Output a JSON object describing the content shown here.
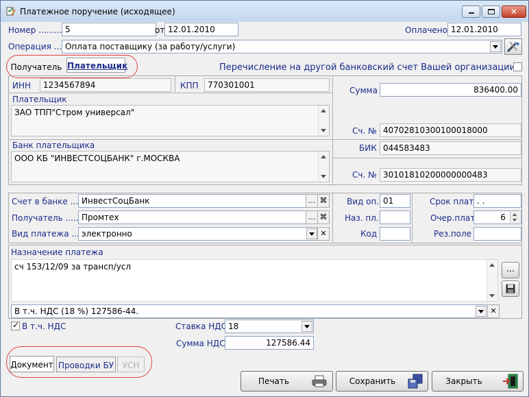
{
  "window": {
    "title": "Платежное поручение (исходящее)",
    "icon": "checklist-pencil-icon",
    "controls": [
      "minimize-icon",
      "maximize-icon",
      "close-icon"
    ]
  },
  "header": {
    "number_label": "Номер ..........",
    "number_value": "5",
    "date_label": "от",
    "date_value": "12.01.2010",
    "paid_label": "Оплачено",
    "paid_value": "12.01.2010",
    "operation_label": "Операция .....",
    "operation_value": "Оплата поставщику (за работу/услуги)"
  },
  "party_tabs": [
    "Получатель",
    "Плательщик"
  ],
  "party_tabs_active": 1,
  "transfer_own_label": "Перечисление на другой банковский счет Вашей организации",
  "transfer_own_checked": false,
  "payer": {
    "inn_label": "ИНН",
    "inn_value": "1234567894",
    "kpp_label": "КПП",
    "kpp_value": "770301001",
    "payer_label": "Плательщик",
    "payer_value": "ЗАО ТПП\"Стром универсал\"",
    "sum_label": "Сумма",
    "sum_value": "836400.00",
    "account_label": "Сч. №",
    "account_value": "40702810300100018000",
    "bank_label": "Банк плательщика",
    "bank_value": "ООО КБ \"ИНВЕСТСОЦБАНК\" г.МОСКВА",
    "bik_label": "БИК",
    "bik_value": "044583483",
    "corr_label": "Сч. №",
    "corr_value": "30101810200000000483"
  },
  "details": {
    "bank_account_label": "Счет в банке ........",
    "bank_account_value": "ИнвестСоцБанк",
    "recipient_label": "Получатель .........",
    "recipient_value": "Промтех",
    "payment_kind_label": "Вид платежа .......",
    "payment_kind_value": "электронно",
    "op_kind_label": "Вид оп.",
    "op_kind_value": "01",
    "purpose_code_label": "Наз. пл.",
    "purpose_code_value": "",
    "code_label": "Код",
    "code_value": "",
    "deadline_label": "Срок плат",
    "deadline_value": ". .",
    "priority_label": "Очер.плат",
    "priority_value": "6",
    "reserve_label": "Рез.поле",
    "reserve_value": ""
  },
  "purpose": {
    "label": "Назначение платежа",
    "text": "сч 153/12/09 за трансп/усл",
    "vat_line": "В т.ч. НДС (18 %) 127586-44."
  },
  "vat": {
    "included_label": "В т.ч. НДС",
    "included_checked": true,
    "rate_label": "Ставка НДС",
    "rate_value": "18",
    "sum_label": "Сумма НДС",
    "sum_value": "127586.44"
  },
  "bottom_tabs": [
    "Документ",
    "Проводки БУ",
    "УСН"
  ],
  "bottom_tabs_active": 0,
  "buttons": {
    "print": "Печать",
    "save": "Сохранить",
    "close": "Закрыть"
  },
  "colors": {
    "label_blue": "#1a2a8a",
    "highlight_oval": "#e04040",
    "title_bar": "#c3d6ec"
  }
}
